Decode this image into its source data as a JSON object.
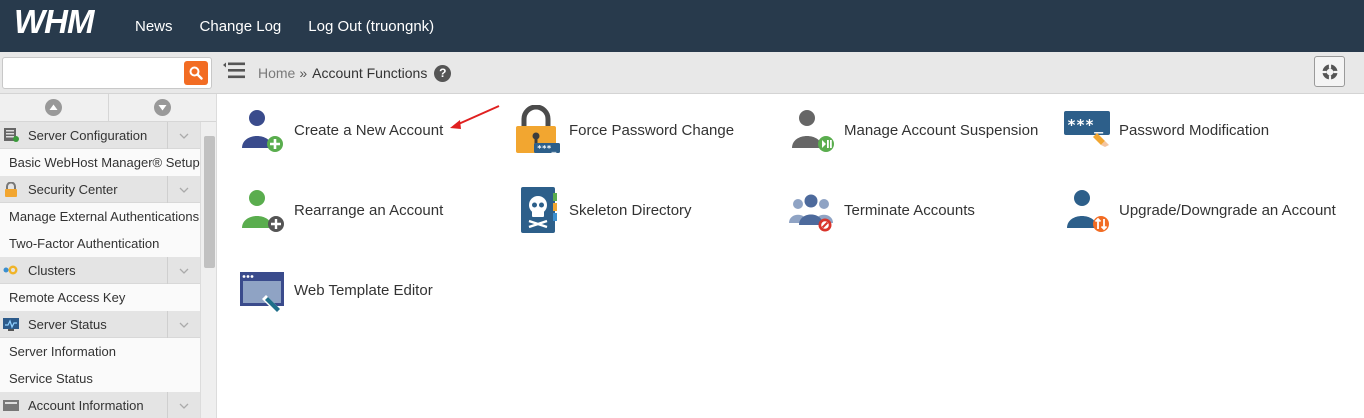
{
  "app": {
    "logo_text": "WHM"
  },
  "topnav": {
    "news": "News",
    "changelog": "Change Log",
    "logout": "Log Out (truongnk)"
  },
  "search": {
    "placeholder": "",
    "value": ""
  },
  "breadcrumb": {
    "home": "Home",
    "separator": "»",
    "current": "Account Functions",
    "help": "?"
  },
  "sidebar": {
    "entries": [
      {
        "type": "category",
        "label": "Server Configuration",
        "icon": "server-config-icon"
      },
      {
        "type": "item",
        "label": "Basic WebHost Manager® Setup"
      },
      {
        "type": "category",
        "label": "Security Center",
        "icon": "lock-icon"
      },
      {
        "type": "item",
        "label": "Manage External Authentications"
      },
      {
        "type": "item",
        "label": "Two-Factor Authentication"
      },
      {
        "type": "category",
        "label": "Clusters",
        "icon": "clusters-icon"
      },
      {
        "type": "item",
        "label": "Remote Access Key"
      },
      {
        "type": "category",
        "label": "Server Status",
        "icon": "monitor-icon"
      },
      {
        "type": "item",
        "label": "Server Information"
      },
      {
        "type": "item",
        "label": "Service Status"
      },
      {
        "type": "category",
        "label": "Account Information",
        "icon": "account-info-icon"
      }
    ]
  },
  "functions": [
    {
      "label": "Create a New Account",
      "icon": "user-add-icon"
    },
    {
      "label": "Force Password Change",
      "icon": "padlock-icon"
    },
    {
      "label": "Manage Account Suspension",
      "icon": "user-suspend-icon"
    },
    {
      "label": "Password Modification",
      "icon": "password-key-icon"
    },
    {
      "label": "Rearrange an Account",
      "icon": "user-move-icon"
    },
    {
      "label": "Skeleton Directory",
      "icon": "skull-book-icon"
    },
    {
      "label": "Terminate Accounts",
      "icon": "users-terminate-icon"
    },
    {
      "label": "Upgrade/Downgrade an Account",
      "icon": "user-upgrade-icon"
    },
    {
      "label": "Web Template Editor",
      "icon": "window-edit-icon"
    }
  ],
  "colors": {
    "topbar": "#283a4c",
    "search_button": "#f26c23",
    "annotation_arrow": "#e02020"
  }
}
